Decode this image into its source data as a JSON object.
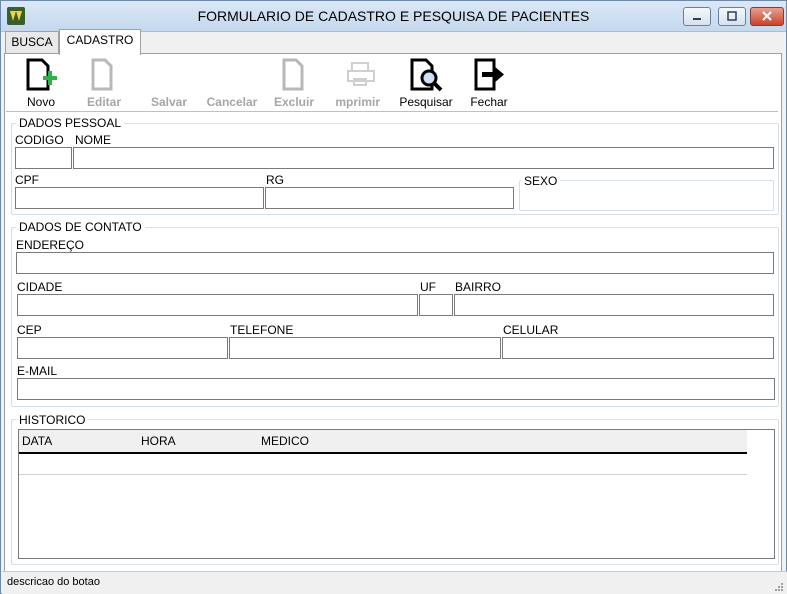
{
  "window": {
    "title": "FORMULARIO DE CADASTRO E PESQUISA DE PACIENTES"
  },
  "tabs": [
    {
      "label": "BUSCA",
      "active": false
    },
    {
      "label": "CADASTRO",
      "active": true
    }
  ],
  "toolbar": {
    "novo": "Novo",
    "editar": "Editar",
    "salvar": "Salvar",
    "cancelar": "Cancelar",
    "excluir": "Excluir",
    "imprimir": "Imprimir",
    "pesquisar": "Pesquisar",
    "fechar": "Fechar"
  },
  "dados_pessoal": {
    "title": "DADOS PESSOAL",
    "codigo_label": "CODIGO",
    "codigo_value": "",
    "nome_label": "NOME",
    "nome_value": "",
    "cpf_label": "CPF",
    "cpf_value": "",
    "rg_label": "RG",
    "rg_value": "",
    "sexo_label": "SEXO"
  },
  "dados_contato": {
    "title": "DADOS DE CONTATO",
    "endereco_label": "ENDEREÇO",
    "endereco_value": "",
    "cidade_label": "CIDADE",
    "cidade_value": "",
    "uf_label": "UF",
    "uf_value": "",
    "bairro_label": "BAIRRO",
    "bairro_value": "",
    "cep_label": "CEP",
    "cep_value": "",
    "telefone_label": "TELEFONE",
    "telefone_value": "",
    "celular_label": "CELULAR",
    "celular_value": "",
    "email_label": "E-MAIL",
    "email_value": ""
  },
  "historico": {
    "title": "HISTORICO",
    "columns": [
      "DATA",
      "HORA",
      "MEDICO"
    ],
    "rows": []
  },
  "status": {
    "text": "descricao do botao"
  },
  "colors": {
    "accent_green": "#2db34a",
    "disabled_gray": "#a6a6a6",
    "close_red": "#c7432c"
  }
}
